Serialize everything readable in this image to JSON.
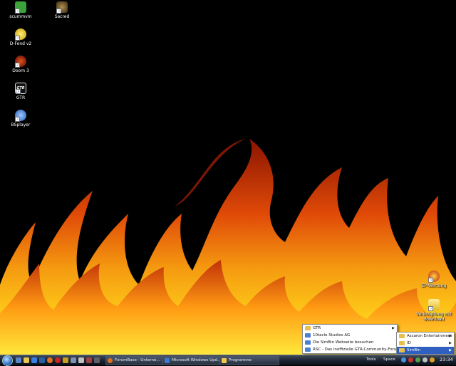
{
  "desktop": {
    "icons": [
      {
        "id": "scummvm",
        "label": "scummvm",
        "color": "#3aa33a"
      },
      {
        "id": "sacred",
        "label": "Sacred",
        "color": "#6a5a3a"
      },
      {
        "id": "dfend",
        "label": "D-Fend v2",
        "color": "#d8b000"
      },
      {
        "id": "doom3",
        "label": "Doom 3",
        "color": "#9a2a10"
      },
      {
        "id": "gtr",
        "label": "GTR",
        "color": "#dddddd"
      },
      {
        "id": "bsplayer",
        "label": "BSplayer",
        "color": "#3a6fd0"
      },
      {
        "id": "ihrwertung",
        "label": "EP-Wertung",
        "color": "#d83020"
      },
      {
        "id": "folder",
        "label": "Verknüpfung mit download",
        "color": "#f2d24a"
      }
    ]
  },
  "context_menu_main": {
    "items": [
      {
        "label": "GTR",
        "submenu": true
      },
      {
        "label": "10tacle Studios AG",
        "submenu": false
      },
      {
        "label": "Die SimBin Webseite besuchen",
        "submenu": false
      },
      {
        "label": "RSC - Das inoffizielle GTR-Community-Forum",
        "submenu": false
      }
    ]
  },
  "context_menu_sub": {
    "items": [
      {
        "label": "Ascaron Entertainment",
        "submenu": true,
        "selected": false
      },
      {
        "label": "ID",
        "submenu": true,
        "selected": false
      },
      {
        "label": "SimBin",
        "submenu": true,
        "selected": true
      }
    ]
  },
  "taskbar": {
    "tasks": [
      {
        "label": "ForumBase - Unterne...",
        "icon_color": "#e07020"
      },
      {
        "label": "Microsoft Windows Upd...",
        "icon_color": "#3a7ad0"
      },
      {
        "label": "Programme",
        "icon_color": "#f2c84a"
      }
    ],
    "toolbar_labels": [
      "Tools",
      "Space"
    ],
    "clock": "23:34"
  },
  "colors": {
    "background": "#000000",
    "menu_highlight": "#2f5fbf",
    "taskbar": "#1a2230"
  }
}
